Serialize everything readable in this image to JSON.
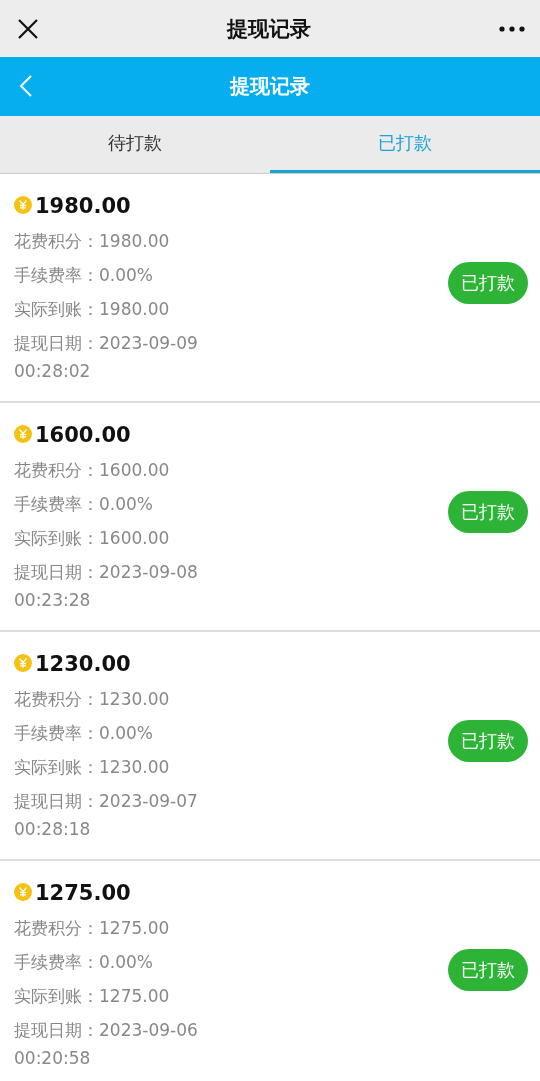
{
  "top_bar": {
    "title": "提现记录"
  },
  "header": {
    "title": "提现记录"
  },
  "tabs": [
    {
      "label": "待打款",
      "selected": false
    },
    {
      "label": "已打款",
      "selected": true
    }
  ],
  "records": [
    {
      "amount": "1980.00",
      "fields": [
        "花费积分：1980.00",
        "手续费率：0.00%",
        "实际到账：1980.00",
        "提现日期：2023-09-09 00:28:02"
      ],
      "status": "已打款"
    },
    {
      "amount": "1600.00",
      "fields": [
        "花费积分：1600.00",
        "手续费率：0.00%",
        "实际到账：1600.00",
        "提现日期：2023-09-08 00:23:28"
      ],
      "status": "已打款"
    },
    {
      "amount": "1230.00",
      "fields": [
        "花费积分：1230.00",
        "手续费率：0.00%",
        "实际到账：1230.00",
        "提现日期：2023-09-07 00:28:18"
      ],
      "status": "已打款"
    },
    {
      "amount": "1275.00",
      "fields": [
        "花费积分：1275.00",
        "手续费率：0.00%",
        "实际到账：1275.00",
        "提现日期：2023-09-06 00:20:58"
      ],
      "status": "已打款"
    }
  ]
}
